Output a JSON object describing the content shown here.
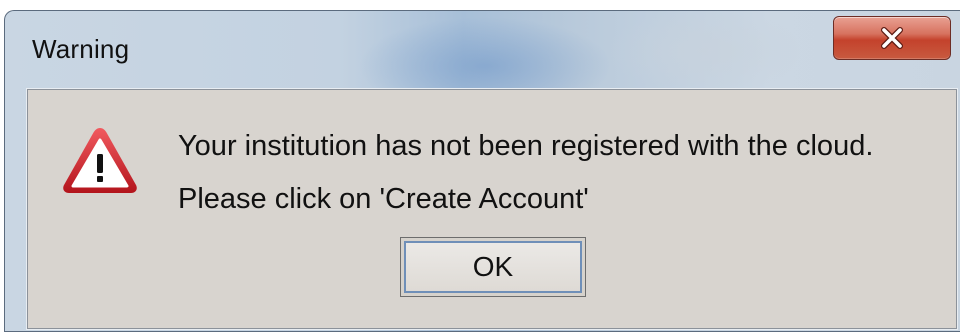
{
  "dialog": {
    "title": "Warning",
    "close_icon": "close-icon",
    "message_line1": "Your institution has not been registered with the cloud.",
    "message_line2": "Please click on 'Create Account'",
    "ok_label": "OK",
    "warning_icon": "warning-triangle-icon"
  },
  "colors": {
    "dialog_background": "#d8d4cf",
    "close_button": "#c4422c",
    "warning_icon": "#c9232b",
    "focus_ring": "#6f8fb8"
  }
}
